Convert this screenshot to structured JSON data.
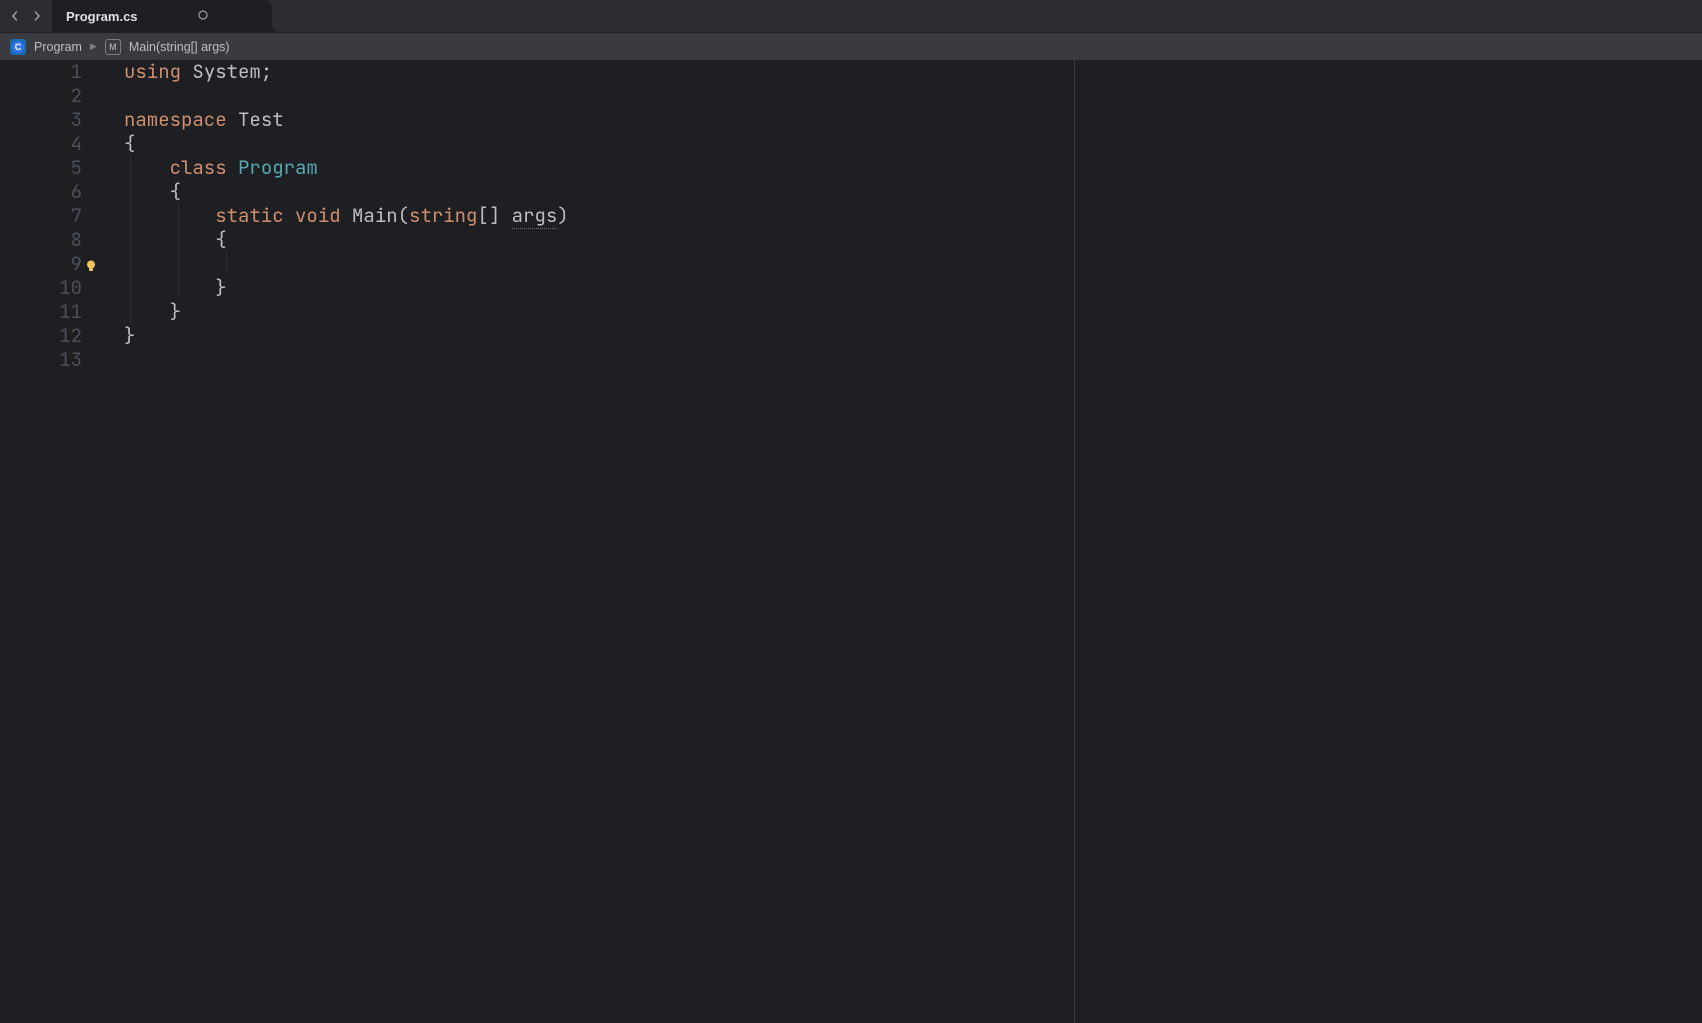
{
  "tab": {
    "title": "Program.cs"
  },
  "breadcrumb": {
    "class_label": "Program",
    "method_label": "Main(string[] args)"
  },
  "gutter": {
    "lines": [
      "1",
      "2",
      "3",
      "4",
      "5",
      "6",
      "7",
      "8",
      "9",
      "10",
      "11",
      "12",
      "13"
    ],
    "bulb_line_index": 8
  },
  "code": {
    "tokens": {
      "using": "using",
      "system": "System",
      "semi": ";",
      "namespace": "namespace",
      "ns_name": "Test",
      "brace_open": "{",
      "brace_close": "}",
      "class_kw": "class",
      "class_name": "Program",
      "static_kw": "static",
      "void_kw": "void",
      "main": "Main",
      "paren_open": "(",
      "paren_close": ")",
      "string_kw": "string",
      "brackets": "[]",
      "args": "args",
      "space": " "
    }
  }
}
